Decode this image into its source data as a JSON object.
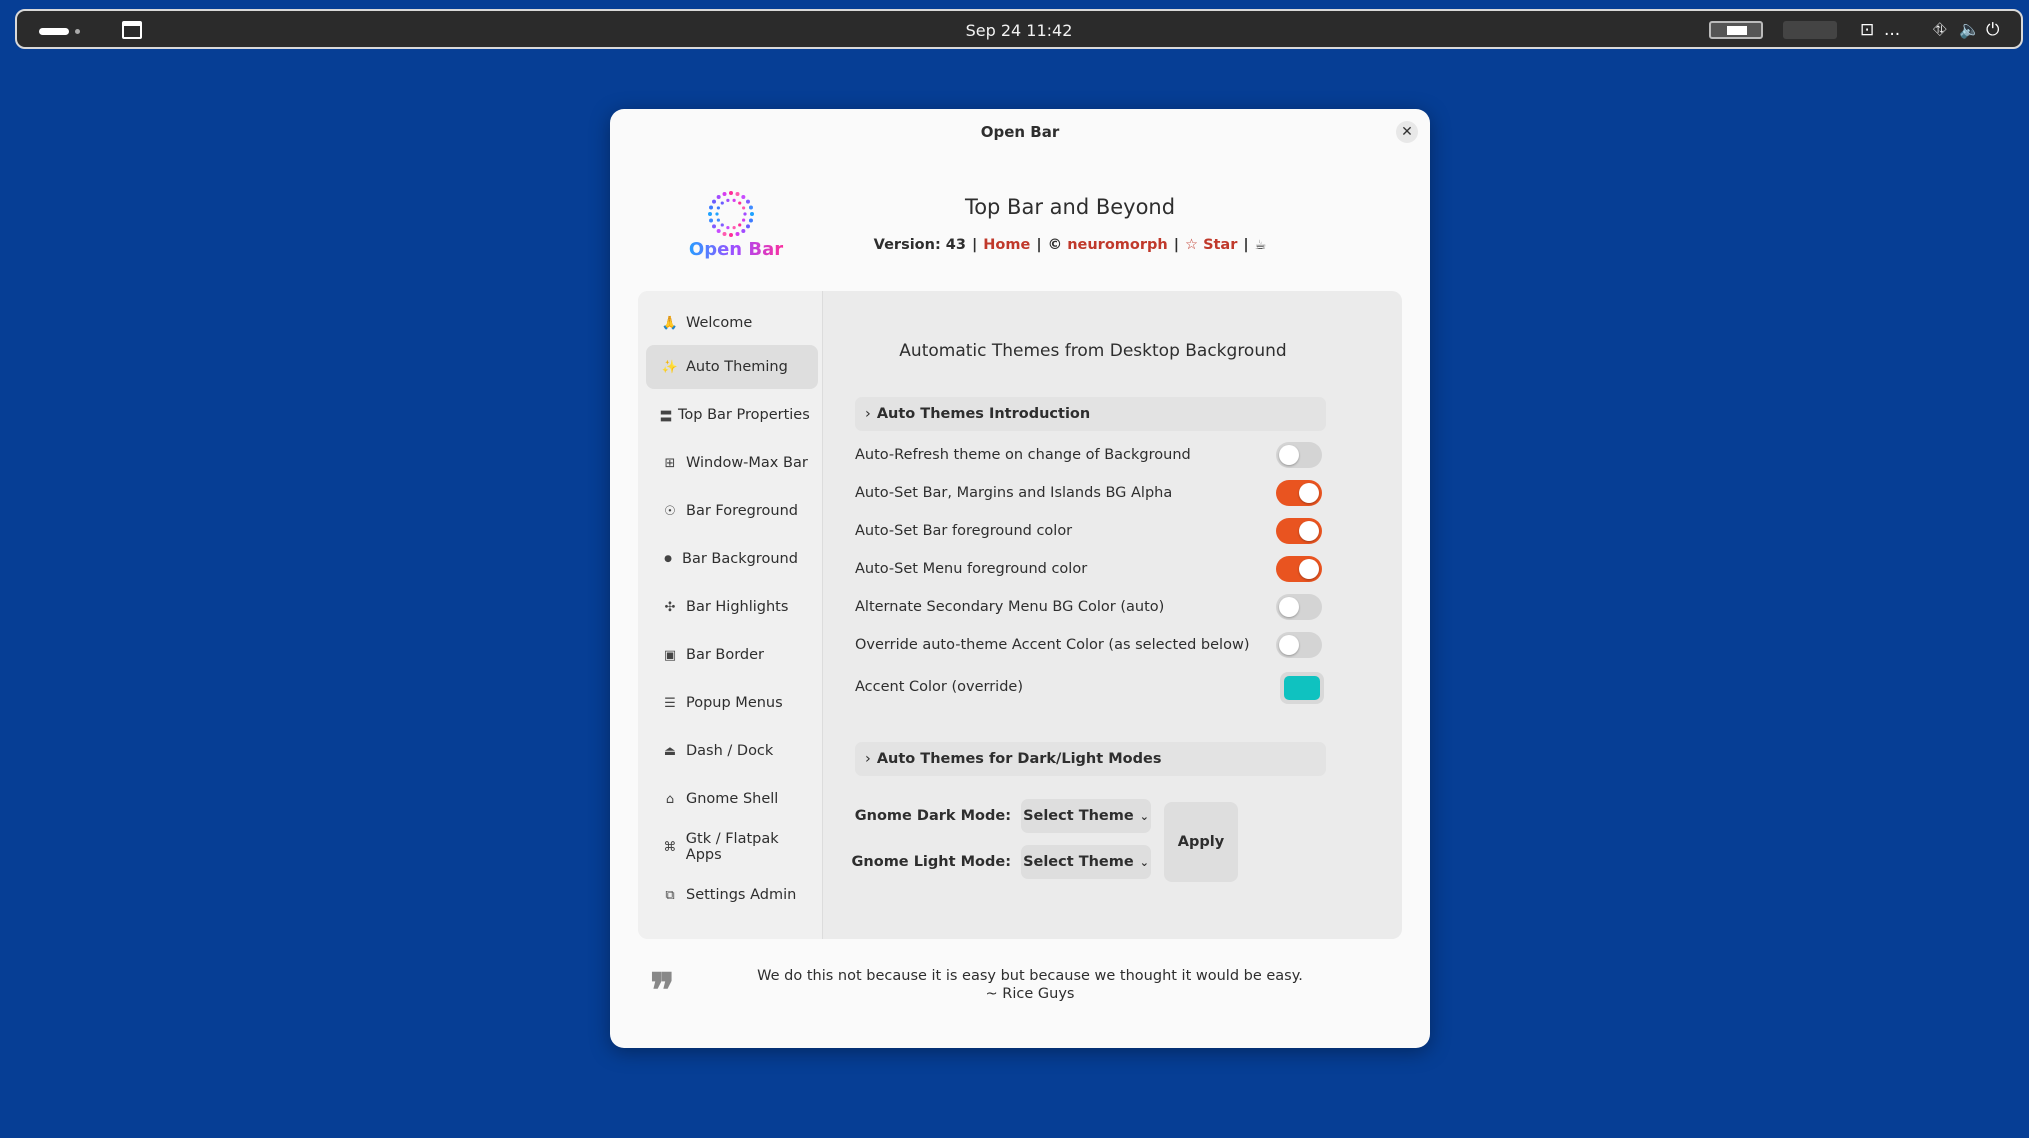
{
  "topbar": {
    "datetime": "Sep 24  11:42",
    "overflow_label": "..."
  },
  "window": {
    "title": "Open Bar",
    "close_glyph": "✕",
    "logo_text": "Open Bar",
    "heading": "Top Bar and Beyond",
    "version_label": "Version: 43",
    "home_link": "Home",
    "author_prefix": "©",
    "author_link": "neuromorph",
    "star_link": "☆ Star",
    "coffee_glyph": "☕",
    "sep": "|"
  },
  "sidebar": {
    "items": [
      {
        "icon": "🙏",
        "label": "Welcome"
      },
      {
        "icon": "✨",
        "label": "Auto Theming"
      },
      {
        "icon": "〓",
        "label": "Top Bar Properties"
      },
      {
        "icon": "⊞",
        "label": "Window-Max Bar"
      },
      {
        "icon": "☉",
        "label": "Bar Foreground"
      },
      {
        "icon": "●",
        "label": "Bar Background"
      },
      {
        "icon": "✣",
        "label": "Bar Highlights"
      },
      {
        "icon": "▣",
        "label": "Bar Border"
      },
      {
        "icon": "☰",
        "label": "Popup Menus"
      },
      {
        "icon": "⏏",
        "label": "Dash / Dock"
      },
      {
        "icon": "⌂",
        "label": "Gnome Shell"
      },
      {
        "icon": "⌘",
        "label": "Gtk / Flatpak Apps"
      },
      {
        "icon": "⧉",
        "label": "Settings Admin"
      }
    ],
    "active_index": 1
  },
  "content": {
    "title": "Automatic Themes from Desktop Background",
    "intro_expander": "Auto Themes Introduction",
    "settings": [
      {
        "label": "Auto-Refresh theme on change of Background",
        "on": false
      },
      {
        "label": "Auto-Set Bar, Margins and Islands BG Alpha",
        "on": true
      },
      {
        "label": "Auto-Set Bar foreground color",
        "on": true
      },
      {
        "label": "Auto-Set Menu foreground color",
        "on": true
      },
      {
        "label": "Alternate Secondary Menu BG Color (auto)",
        "on": false
      },
      {
        "label": "Override auto-theme Accent Color (as selected below)",
        "on": false
      }
    ],
    "accent_label": "Accent Color (override)",
    "accent_color": "#0fc2c0",
    "modes_expander": "Auto Themes for Dark/Light Modes",
    "dark_mode_label": "Gnome Dark Mode:",
    "light_mode_label": "Gnome Light Mode:",
    "dark_mode_value": "Select Theme",
    "light_mode_value": "Select Theme",
    "apply_label": "Apply"
  },
  "footer": {
    "quote_mark": "❞",
    "quote_line1": "We do this not because it is easy but because we thought it would be easy.",
    "quote_line2": "~ Rice Guys"
  },
  "colors": {
    "desktop": "#063e95",
    "toggle_on": "#e95420",
    "link": "#c0392b"
  }
}
